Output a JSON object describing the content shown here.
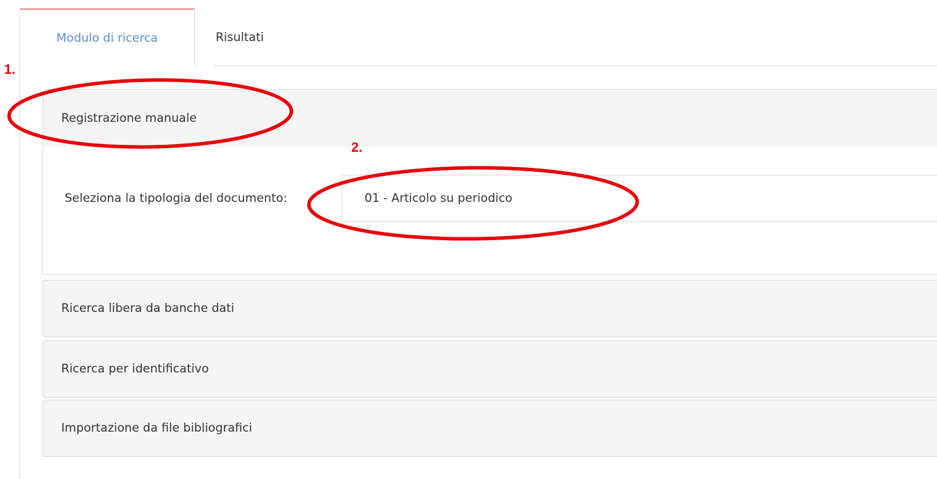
{
  "tabs": {
    "search_form": "Modulo di ricerca",
    "results": "Risultati"
  },
  "panels": {
    "manual": {
      "title": "Registrazione manuale",
      "field_label": "Seleziona la tipologia del documento:",
      "document_type_value": "01 - Articolo su periodico"
    },
    "free_search": "Ricerca libera da banche dati",
    "identifier_search": "Ricerca per identificativo",
    "import_files": "Importazione da file bibliografici"
  },
  "annotations": {
    "step1": "1.",
    "step2": "2.",
    "color": "#e8000a"
  },
  "colors": {
    "active_tab_text": "#5b8fc9",
    "active_tab_border": "#e98a80",
    "panel_bg": "#f5f5f5"
  }
}
